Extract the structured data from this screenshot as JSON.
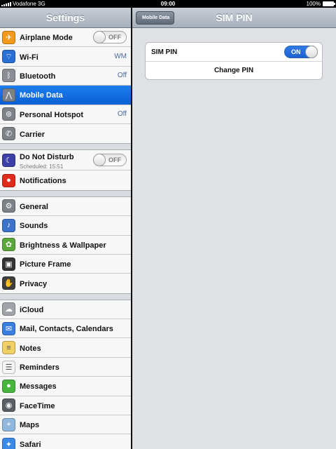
{
  "status": {
    "carrier": "Vodafone 3G",
    "time": "09:00",
    "battery": "100%"
  },
  "master": {
    "title": "Settings",
    "groups": [
      [
        {
          "label": "Airplane Mode",
          "icon": "airplane-icon",
          "color": "#f39a1d",
          "toggle": "OFF"
        },
        {
          "label": "Wi-Fi",
          "icon": "wifi-icon",
          "color": "#2a6fd6",
          "value": "WM"
        },
        {
          "label": "Bluetooth",
          "icon": "bluetooth-icon",
          "color": "#8b8f95",
          "value": "Off"
        },
        {
          "label": "Mobile Data",
          "icon": "antenna-icon",
          "color": "#7d8289",
          "selected": true
        },
        {
          "label": "Personal Hotspot",
          "icon": "hotspot-icon",
          "color": "#7d8289",
          "value": "Off"
        },
        {
          "label": "Carrier",
          "icon": "phone-icon",
          "color": "#7d8289"
        }
      ],
      [
        {
          "label": "Do Not Disturb",
          "sub": "Scheduled: 15:51",
          "icon": "moon-icon",
          "color": "#3b3fa6",
          "toggle": "OFF"
        },
        {
          "label": "Notifications",
          "icon": "notifications-icon",
          "color": "#e22a1c"
        }
      ],
      [
        {
          "label": "General",
          "icon": "gear-icon",
          "color": "#7d8289"
        },
        {
          "label": "Sounds",
          "icon": "speaker-icon",
          "color": "#3d73c9"
        },
        {
          "label": "Brightness & Wallpaper",
          "icon": "flower-icon",
          "color": "#5aa73b"
        },
        {
          "label": "Picture Frame",
          "icon": "frame-icon",
          "color": "#333"
        },
        {
          "label": "Privacy",
          "icon": "hand-icon",
          "color": "#3e3e3e"
        }
      ],
      [
        {
          "label": "iCloud",
          "icon": "cloud-icon",
          "color": "#a0a4aa"
        },
        {
          "label": "Mail, Contacts, Calendars",
          "icon": "mail-icon",
          "color": "#3a7ee0"
        },
        {
          "label": "Notes",
          "icon": "notes-icon",
          "color": "#f1d166"
        },
        {
          "label": "Reminders",
          "icon": "reminders-icon",
          "color": "#f5f5f5"
        },
        {
          "label": "Messages",
          "icon": "messages-icon",
          "color": "#48b53f"
        },
        {
          "label": "FaceTime",
          "icon": "facetime-icon",
          "color": "#5a5f66"
        },
        {
          "label": "Maps",
          "icon": "maps-icon",
          "color": "#8fb8dc"
        },
        {
          "label": "Safari",
          "icon": "compass-icon",
          "color": "#3c88e6"
        }
      ]
    ]
  },
  "detail": {
    "back": "Mobile Data",
    "title": "SIM PIN",
    "sim_pin_label": "SIM PIN",
    "sim_pin_toggle": "ON",
    "change_pin": "Change PIN"
  }
}
